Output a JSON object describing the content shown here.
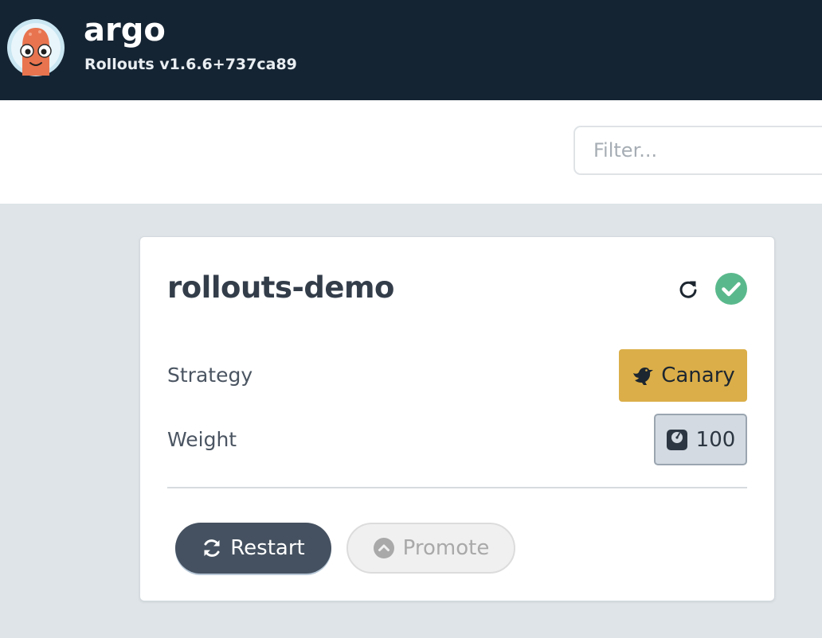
{
  "header": {
    "brand": "argo",
    "version": "Rollouts v1.6.6+737ca89"
  },
  "toolbar": {
    "filter_placeholder": "Filter...",
    "filter_value": ""
  },
  "rollout": {
    "name": "rollouts-demo",
    "status": "healthy",
    "strategy_label": "Strategy",
    "strategy_value": "Canary",
    "weight_label": "Weight",
    "weight_value": "100",
    "actions": {
      "restart_label": "Restart",
      "promote_label": "Promote"
    }
  },
  "colors": {
    "header_bg": "#152433",
    "page_bg": "#dee4e8",
    "healthy": "#5ab98c",
    "canary_badge": "#dbae49",
    "restart_button": "#455160"
  },
  "icons": {
    "logo": "argo-octopus-logo",
    "refresh": "refresh-icon",
    "status": "check-circle-icon",
    "strategy": "canary-bird-icon",
    "weight": "weight-scale-icon",
    "restart": "sync-icon",
    "promote": "chevron-circle-up-icon"
  }
}
